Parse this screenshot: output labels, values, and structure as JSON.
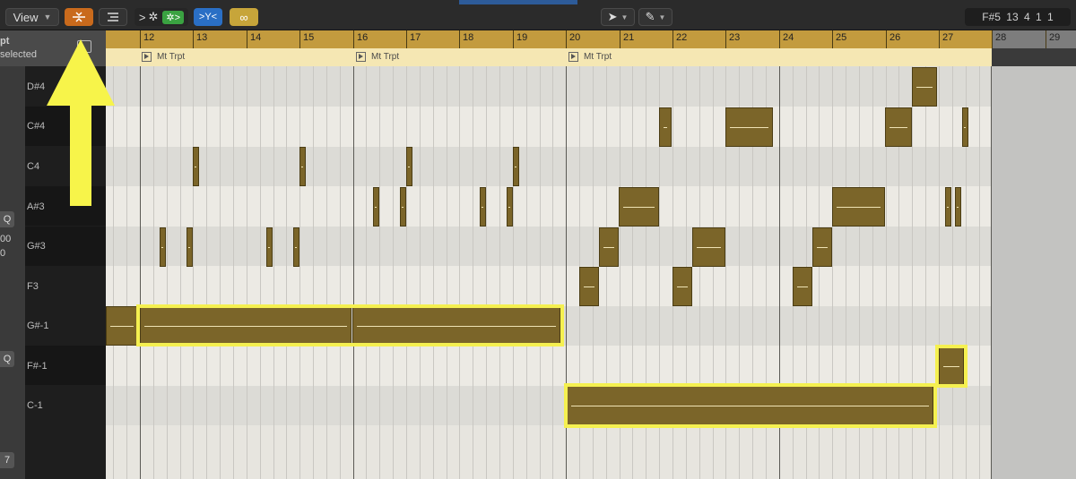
{
  "toolbar": {
    "view_label": "View",
    "midi_left": ">",
    "midi_right": ">",
    "lcd": "F#5  13 4 1 1"
  },
  "inspector": {
    "title_fragment": "pt",
    "subtitle_fragment": "selected",
    "q1": "Q",
    "v1": "00",
    "v2": "0",
    "q2": "Q",
    "n7": "7"
  },
  "keyboard": {
    "labels": [
      "D#4",
      "C#4",
      "C4",
      "A#3",
      "G#3",
      "F3",
      "G#-1",
      "F#-1",
      "C-1"
    ]
  },
  "ruler": {
    "bars": [
      "12",
      "13",
      "14",
      "15",
      "16",
      "17",
      "18",
      "19",
      "20",
      "21",
      "22",
      "23",
      "24",
      "25",
      "26",
      "27",
      "28",
      "29"
    ]
  },
  "regions": [
    {
      "name": "Mt Trpt"
    },
    {
      "name": "Mt Trpt"
    },
    {
      "name": "Mt Trpt"
    }
  ],
  "colors": {
    "note_fill": "#7b6529",
    "highlight": "#f5f050",
    "ruler": "#c39b3e",
    "region_band": "#f5e7b3"
  },
  "annotation": {
    "arrow": "up-arrow",
    "color": "#f7f44a"
  }
}
